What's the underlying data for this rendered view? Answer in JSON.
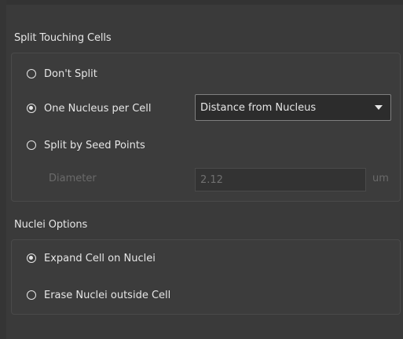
{
  "split_section": {
    "title": "Split Touching Cells",
    "options": [
      {
        "label": "Don't Split",
        "checked": false
      },
      {
        "label": "One Nucleus per Cell",
        "checked": true
      },
      {
        "label": "Split by Seed Points",
        "checked": false
      }
    ],
    "method_select": {
      "value": "Distance from Nucleus"
    },
    "diameter": {
      "label": "Diameter",
      "value": "2.12",
      "unit": "um",
      "enabled": false
    }
  },
  "nuclei_section": {
    "title": "Nuclei Options",
    "options": [
      {
        "label": "Expand Cell on Nuclei",
        "checked": true
      },
      {
        "label": "Erase Nuclei outside Cell",
        "checked": false
      }
    ]
  }
}
